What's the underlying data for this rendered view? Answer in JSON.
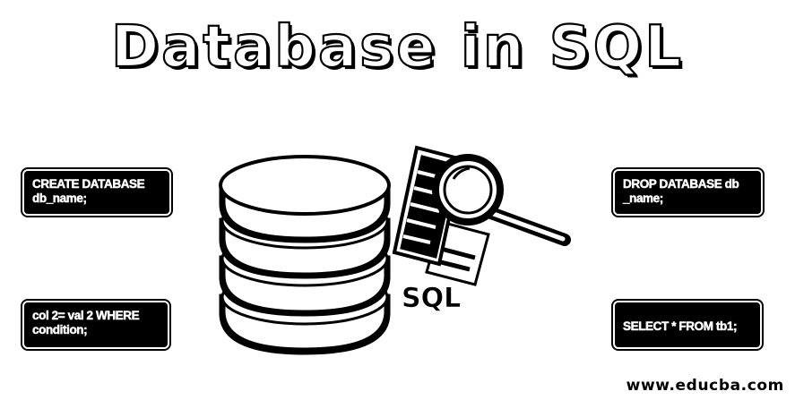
{
  "title": "Database in SQL",
  "boxes": {
    "create": {
      "line1": "CREATE DATABASE",
      "line2": "db_name;"
    },
    "drop": {
      "line1": "DROP DATABASE db",
      "line2": "_name;"
    },
    "update": {
      "line1": "col 2= val 2 WHERE",
      "line2": "condition;"
    },
    "select": {
      "line1": "SELECT * FROM tb1;"
    }
  },
  "illustration": {
    "label": "SQL",
    "icons": [
      "database-icon",
      "document-icon",
      "magnifier-icon"
    ]
  },
  "watermark": "www.educba.com"
}
